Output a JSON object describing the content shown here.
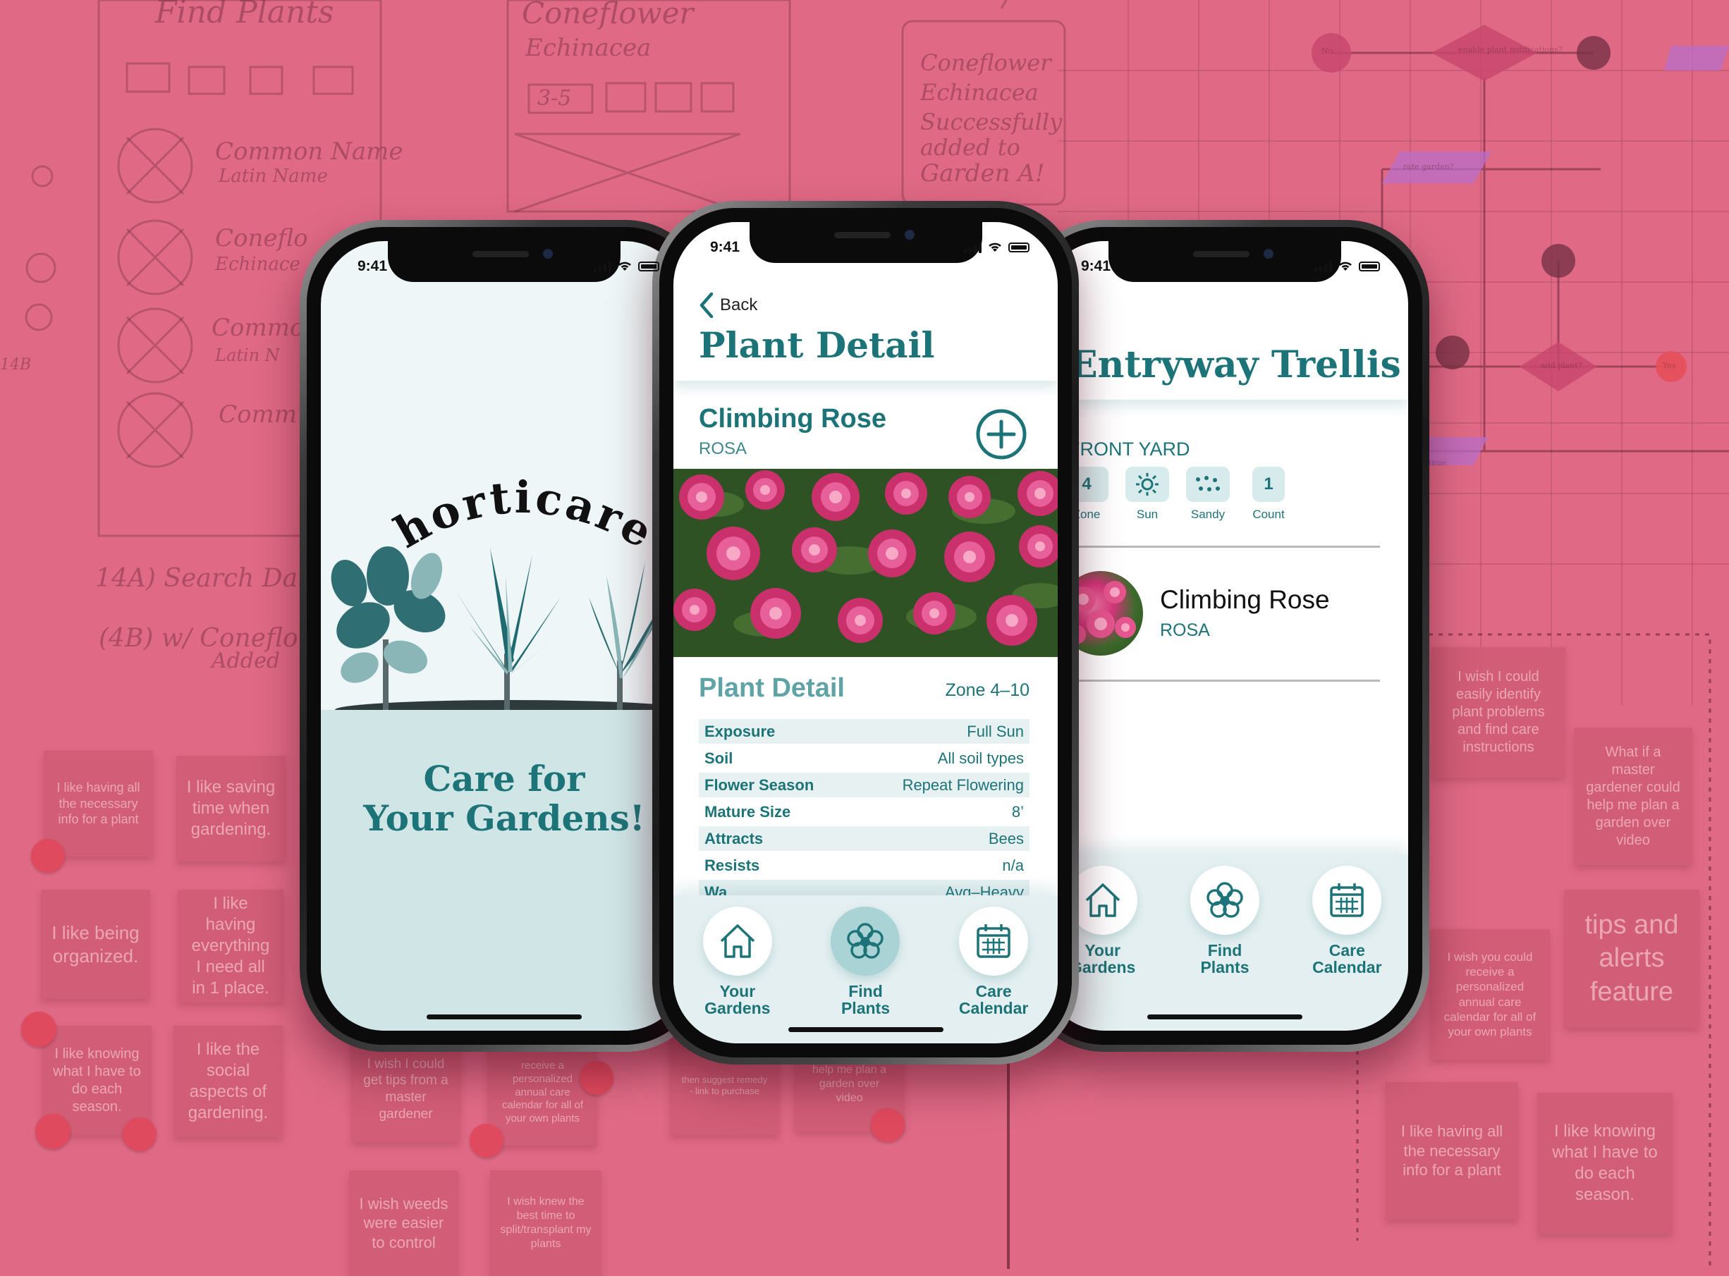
{
  "background": {
    "color": "#e06a86",
    "sketches": [
      "Find Plants",
      "Coneflower",
      "Echinacea",
      "3-5",
      "Common Name",
      "Latin Name",
      "Coneflo",
      "Echinace",
      "Common",
      "Latin N",
      "Comm",
      "Coneflower",
      "Echinacea",
      "Successfully",
      "added to",
      "Garden A!",
      "14A) Search Data",
      "(4B) w/ Coneflower",
      "Added",
      "14B"
    ],
    "sticky_notes": [
      "I like having all the necessary info for a plant",
      "I like saving time when gardening.",
      "I like being organized.",
      "I like having everything I need all in 1 place.",
      "I like knowing what I have to do each season.",
      "I like the social aspects of gardening.",
      "I wish I could get tips from a master gardener",
      "receive a personalized annual care calendar for all of your own plants",
      "then suggest remedy - link to purchase",
      "help me plan a garden over video",
      "I wish weeds were easier to control",
      "I wish knew the best time to split/transplant my plants",
      "I wish I could easily identify plant problems and find care instructions",
      "What if a master gardener could help me plan a garden over video",
      "tips and alerts feature",
      "I wish you could receive a personalized annual care calendar for all of your own plants",
      "I like having all the necessary info for a plant",
      "I like knowing what I have to do each season."
    ],
    "flowchart_labels": [
      "No",
      "enable plant notifications?",
      "Yes",
      "rate garden?",
      "add plant?",
      "Continue"
    ]
  },
  "brand": {
    "teal": "#1d7478",
    "light_teal": "#cfe5e6"
  },
  "phones": {
    "left": {
      "time": "9:41",
      "logo": "horticare",
      "tagline_line1": "Care for",
      "tagline_line2": "Your Gardens!"
    },
    "center": {
      "time": "9:41",
      "back_label": "Back",
      "title": "Plant Detail",
      "plant_name": "Climbing Rose",
      "plant_latin": "ROSA",
      "add_icon": "plus-circle-icon",
      "section_title": "Plant Detail",
      "zone": "Zone 4–10",
      "details": [
        {
          "key": "Exposure",
          "value": "Full Sun"
        },
        {
          "key": "Soil",
          "value": "All soil types"
        },
        {
          "key": "Flower Season",
          "value": "Repeat Flowering"
        },
        {
          "key": "Mature Size",
          "value": "8’"
        },
        {
          "key": "Attracts",
          "value": "Bees"
        },
        {
          "key": "Resists",
          "value": "n/a"
        },
        {
          "key": "Wa",
          "value": "Avg–Heavy"
        }
      ],
      "nav": [
        {
          "label": "Your\nGardens",
          "icon": "house-icon"
        },
        {
          "label": "Find\nPlants",
          "icon": "flower-icon"
        },
        {
          "label": "Care\nCalendar",
          "icon": "calendar-icon"
        }
      ]
    },
    "right": {
      "time": "9:41",
      "title": "Entryway Trellis",
      "location": "FRONT YARD",
      "conditions": [
        {
          "value": "4",
          "label": "Zone"
        },
        {
          "value": "",
          "label": "Sun",
          "icon": "sun-icon"
        },
        {
          "value": "",
          "label": "Sandy",
          "icon": "dots-icon"
        },
        {
          "value": "1",
          "label": "Count"
        }
      ],
      "plant_name": "Climbing Rose",
      "plant_latin": "ROSA",
      "nav": [
        {
          "label": "Your\nGardens",
          "icon": "house-icon"
        },
        {
          "label": "Find\nPlants",
          "icon": "flower-icon"
        },
        {
          "label": "Care\nCalendar",
          "icon": "calendar-icon"
        }
      ]
    }
  }
}
